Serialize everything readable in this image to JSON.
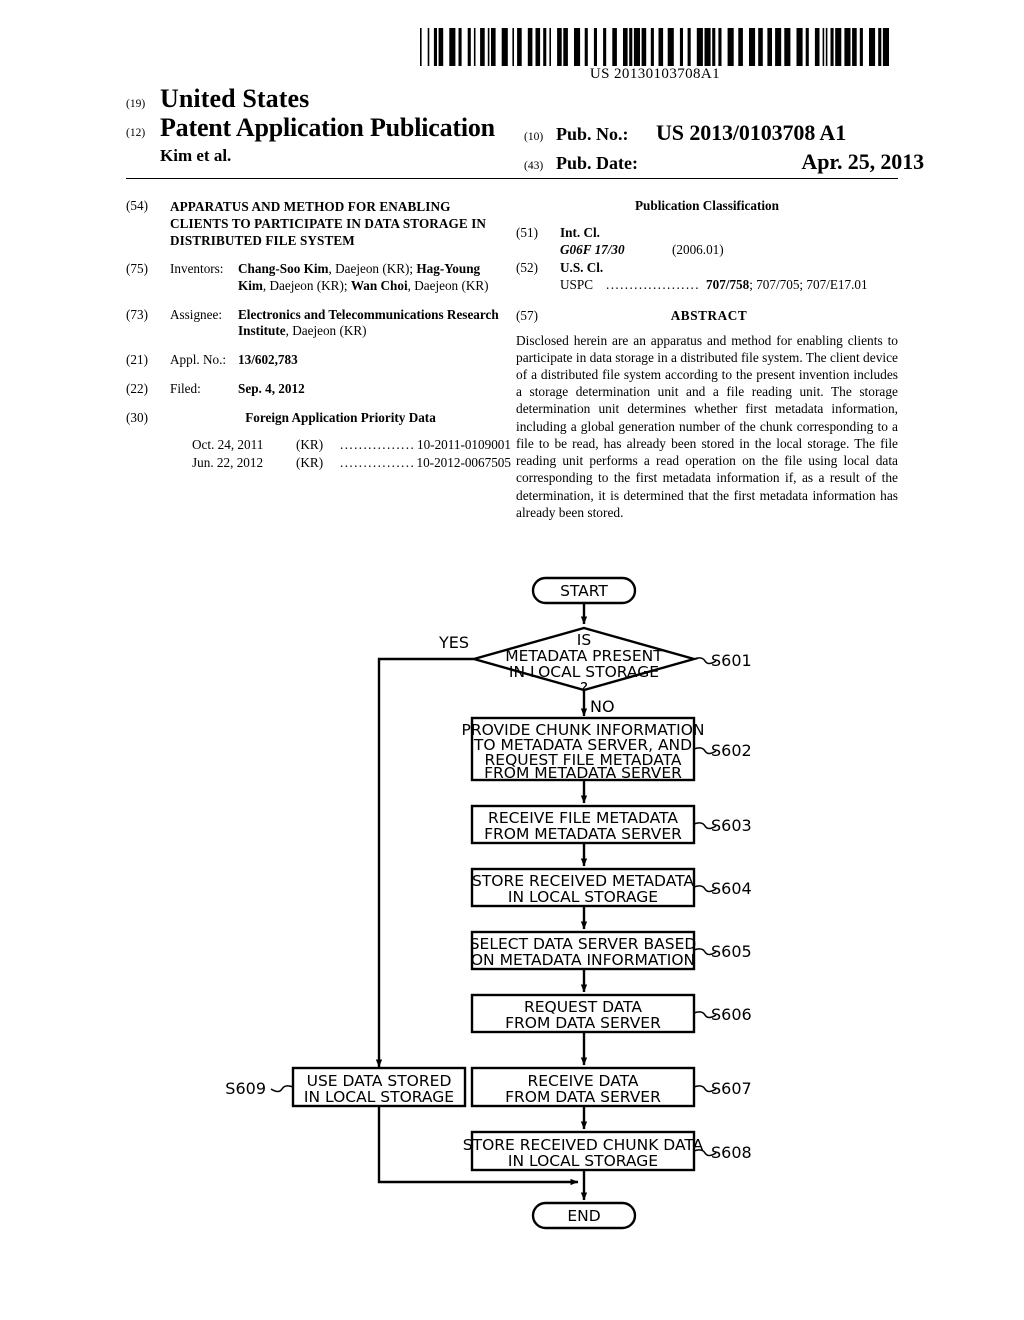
{
  "barcode": {
    "number": "US 20130103708A1",
    "name": "barcode"
  },
  "masthead": {
    "inid_country": "(19)",
    "country": "United States",
    "inid_doctype": "(12)",
    "doctype": "Patent Application Publication",
    "authors": "Kim et al.",
    "inid_pubno": "(10)",
    "pubno_label": "Pub. No.:",
    "pubno_value": "US 2013/0103708 A1",
    "inid_pubdate": "(43)",
    "pubdate_label": "Pub. Date:",
    "pubdate_value": "Apr. 25, 2013"
  },
  "left_column": {
    "title": {
      "inid": "(54)",
      "text": "APPARATUS AND METHOD FOR ENABLING CLIENTS TO PARTICIPATE IN DATA STORAGE IN DISTRIBUTED FILE SYSTEM"
    },
    "inventors": {
      "inid": "(75)",
      "key": "Inventors:",
      "list": [
        {
          "name": "Chang-Soo Kim",
          "loc": ", Daejeon (KR);"
        },
        {
          "name": "Hag-Young Kim",
          "loc": ", Daejeon (KR);"
        },
        {
          "name": "Wan Choi",
          "loc": ", Daejeon (KR)"
        }
      ]
    },
    "assignee": {
      "inid": "(73)",
      "key": "Assignee:",
      "name": "Electronics and Telecommunications Research Institute",
      "loc": ", Daejeon (KR)"
    },
    "appl_no": {
      "inid": "(21)",
      "key": "Appl. No.:",
      "value": "13/602,783"
    },
    "filed": {
      "inid": "(22)",
      "key": "Filed:",
      "value": "Sep. 4, 2012"
    },
    "foreign": {
      "inid": "(30)",
      "heading": "Foreign Application Priority Data",
      "rows": [
        {
          "date": "Oct. 24, 2011",
          "cc": "(KR)",
          "dots": "........................",
          "number": "10-2011-0109001"
        },
        {
          "date": "Jun. 22, 2012",
          "cc": "(KR)",
          "dots": "........................",
          "number": "10-2012-0067505"
        }
      ]
    }
  },
  "right_column": {
    "classification_heading": "Publication Classification",
    "int_cl": {
      "inid": "(51)",
      "label": "Int. Cl.",
      "code": "G06F 17/30",
      "edition": "(2006.01)"
    },
    "us_cl": {
      "inid": "(52)",
      "label": "U.S. Cl.",
      "uspc_label": "USPC",
      "dots": "....................",
      "primary": "707/758",
      "rest": "; 707/705; 707/E17.01"
    },
    "abstract": {
      "inid": "(57)",
      "heading": "ABSTRACT",
      "text": "Disclosed herein are an apparatus and method for enabling clients to participate in data storage in a distributed file system. The client device of a distributed file system according to the present invention includes a storage determination unit and a file reading unit. The storage determination unit determines whether first metadata information, including a global generation number of the chunk corresponding to a file to be read, has already been stored in the local storage. The file reading unit performs a read operation on the file using local data corresponding to the first metadata information if, as a result of the determination, it is determined that the first metadata information has already been stored."
    }
  },
  "flowchart": {
    "start": "START",
    "end": "END",
    "decision": {
      "lines": [
        "IS",
        "METADATA PRESENT",
        "IN LOCAL STORAGE",
        "?"
      ],
      "step": "S601",
      "yes_label": "YES",
      "no_label": "NO"
    },
    "steps": [
      {
        "step": "S602",
        "lines": [
          "PROVIDE CHUNK INFORMATION",
          "TO METADATA SERVER, AND",
          "REQUEST FILE METADATA",
          "FROM METADATA SERVER"
        ]
      },
      {
        "step": "S603",
        "lines": [
          "RECEIVE FILE METADATA",
          "FROM METADATA SERVER"
        ]
      },
      {
        "step": "S604",
        "lines": [
          "STORE RECEIVED METADATA",
          "IN LOCAL STORAGE"
        ]
      },
      {
        "step": "S605",
        "lines": [
          "SELECT DATA SERVER BASED",
          "ON METADATA INFORMATION"
        ]
      },
      {
        "step": "S606",
        "lines": [
          "REQUEST DATA",
          "FROM DATA SERVER"
        ]
      },
      {
        "step": "S607",
        "lines": [
          "RECEIVE DATA",
          "FROM DATA SERVER"
        ]
      },
      {
        "step": "S608",
        "lines": [
          "STORE RECEIVED CHUNK DATA",
          "IN LOCAL STORAGE"
        ]
      }
    ],
    "yes_branch": {
      "step": "S609",
      "lines": [
        "USE DATA STORED",
        "IN LOCAL STORAGE"
      ]
    }
  }
}
